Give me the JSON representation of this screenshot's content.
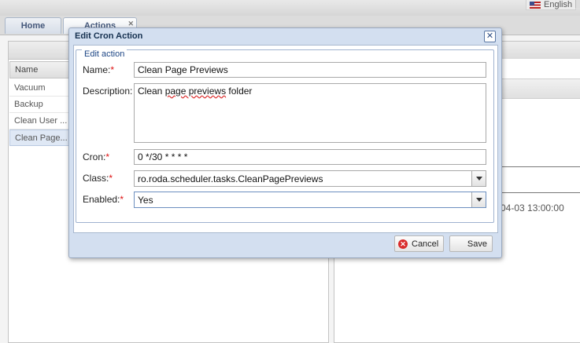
{
  "topbar": {
    "language": "English"
  },
  "tabs": [
    {
      "label": "Home"
    },
    {
      "label": "Actions"
    }
  ],
  "list": {
    "column_header": "Name",
    "rows": [
      "Vacuum",
      "Backup",
      "Clean User ...",
      "Clean Page..."
    ]
  },
  "right_panel": {
    "date_fragment": "04-03 13:00:00"
  },
  "dialog": {
    "title": "Edit Cron Action",
    "legend": "Edit action",
    "fields": {
      "name": {
        "label": "Name:",
        "value": "Clean Page Previews"
      },
      "description": {
        "label": "Description:",
        "value_pre": "Clean ",
        "value_spell": "page previews",
        "value_post": " folder"
      },
      "cron": {
        "label": "Cron:",
        "value": "0 */30 * * * *"
      },
      "class": {
        "label": "Class:",
        "value": "ro.roda.scheduler.tasks.CleanPagePreviews"
      },
      "enabled": {
        "label": "Enabled:",
        "value": "Yes"
      }
    },
    "buttons": {
      "cancel": "Cancel",
      "save": "Save"
    }
  }
}
